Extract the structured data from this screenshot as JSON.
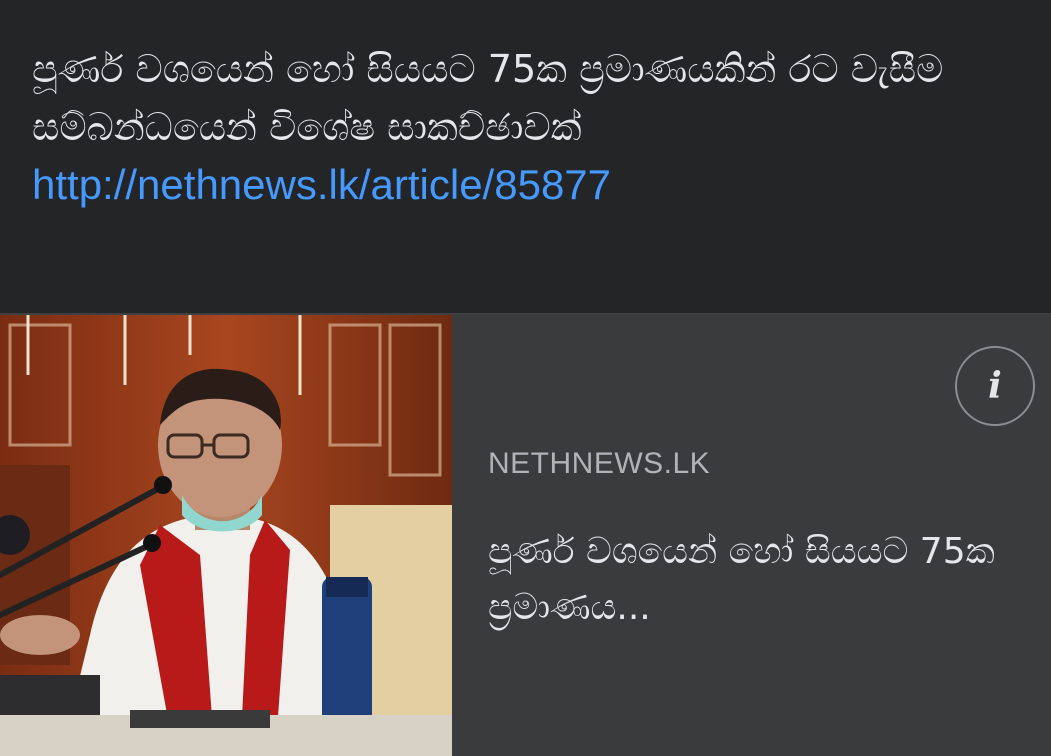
{
  "post": {
    "text": "පූර්ණ වශයෙන් හෝ සියයට 75ක ප්‍රමාණයකින් රට වැසීම සම්බන්ධයෙන් විශේෂ සාකච්ඡාවක්",
    "link": "http://nethnews.lk/article/85877"
  },
  "preview": {
    "domain": "NETHNEWS.LK",
    "title": "පූර්ණ වශයෙන් හෝ සියයට 75ක ප්‍රමාණය...",
    "info_icon": "info-icon",
    "info_glyph": "i"
  },
  "colors": {
    "background": "#242526",
    "preview_background": "#3a3b3c",
    "link": "#4599ff",
    "text": "#e4e6eb",
    "muted": "#b0b3b8"
  }
}
